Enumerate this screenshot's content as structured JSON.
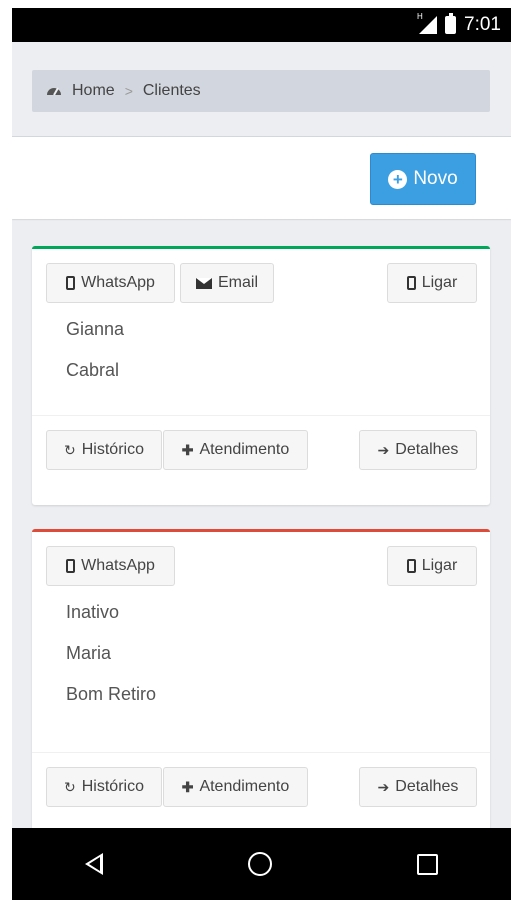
{
  "status": {
    "time": "7:01",
    "network": "H"
  },
  "breadcrumb": {
    "home": "Home",
    "separator": ">",
    "current": "Clientes"
  },
  "toolbar": {
    "new_label": "Novo"
  },
  "clients": [
    {
      "status_color": "#00a65a",
      "whatsapp": "WhatsApp",
      "email": "Email",
      "call": "Ligar",
      "lines": [
        "Gianna",
        "Cabral"
      ],
      "history": "Histórico",
      "service": "Atendimento",
      "details": "Detalhes"
    },
    {
      "status_color": "#dd4b39",
      "whatsapp": "WhatsApp",
      "call": "Ligar",
      "lines": [
        "Inativo",
        "Maria",
        "Bom Retiro"
      ],
      "history": "Histórico",
      "service": "Atendimento",
      "details": "Detalhes"
    }
  ],
  "icons": [
    "phone-icon",
    "mail-icon",
    "refresh-icon",
    "plus-icon",
    "arrow-right-icon",
    "dashboard-icon"
  ]
}
